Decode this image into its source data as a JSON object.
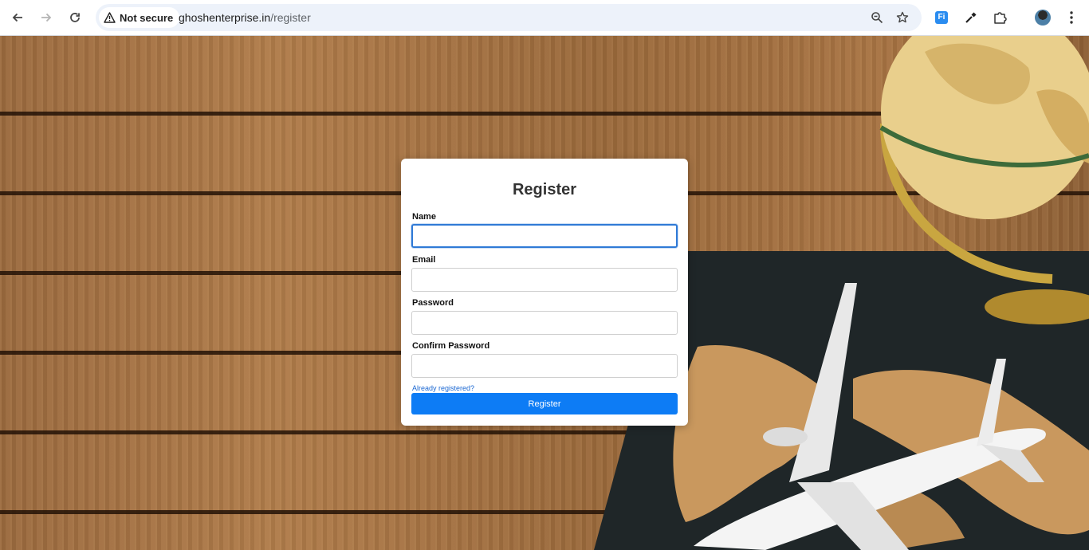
{
  "browser": {
    "back_icon": "arrow-left-icon",
    "forward_icon": "arrow-right-icon",
    "reload_icon": "reload-icon",
    "security_label": "Not secure",
    "url_host": "ghoshenterprise.in",
    "url_path": "/register",
    "zoom_icon": "zoom-icon",
    "bookmark_icon": "star-icon",
    "extension_fi_label": "Fi",
    "eyedropper_icon": "eyedropper-icon",
    "extensions_icon": "puzzle-icon",
    "menu_icon": "kebab-menu-icon"
  },
  "form": {
    "title": "Register",
    "name_label": "Name",
    "email_label": "Email",
    "password_label": "Password",
    "confirm_password_label": "Confirm Password",
    "name_value": "",
    "email_value": "",
    "password_value": "",
    "confirm_password_value": "",
    "login_link": "Already registered?",
    "submit_label": "Register",
    "accent_color": "#0d7cf5"
  }
}
